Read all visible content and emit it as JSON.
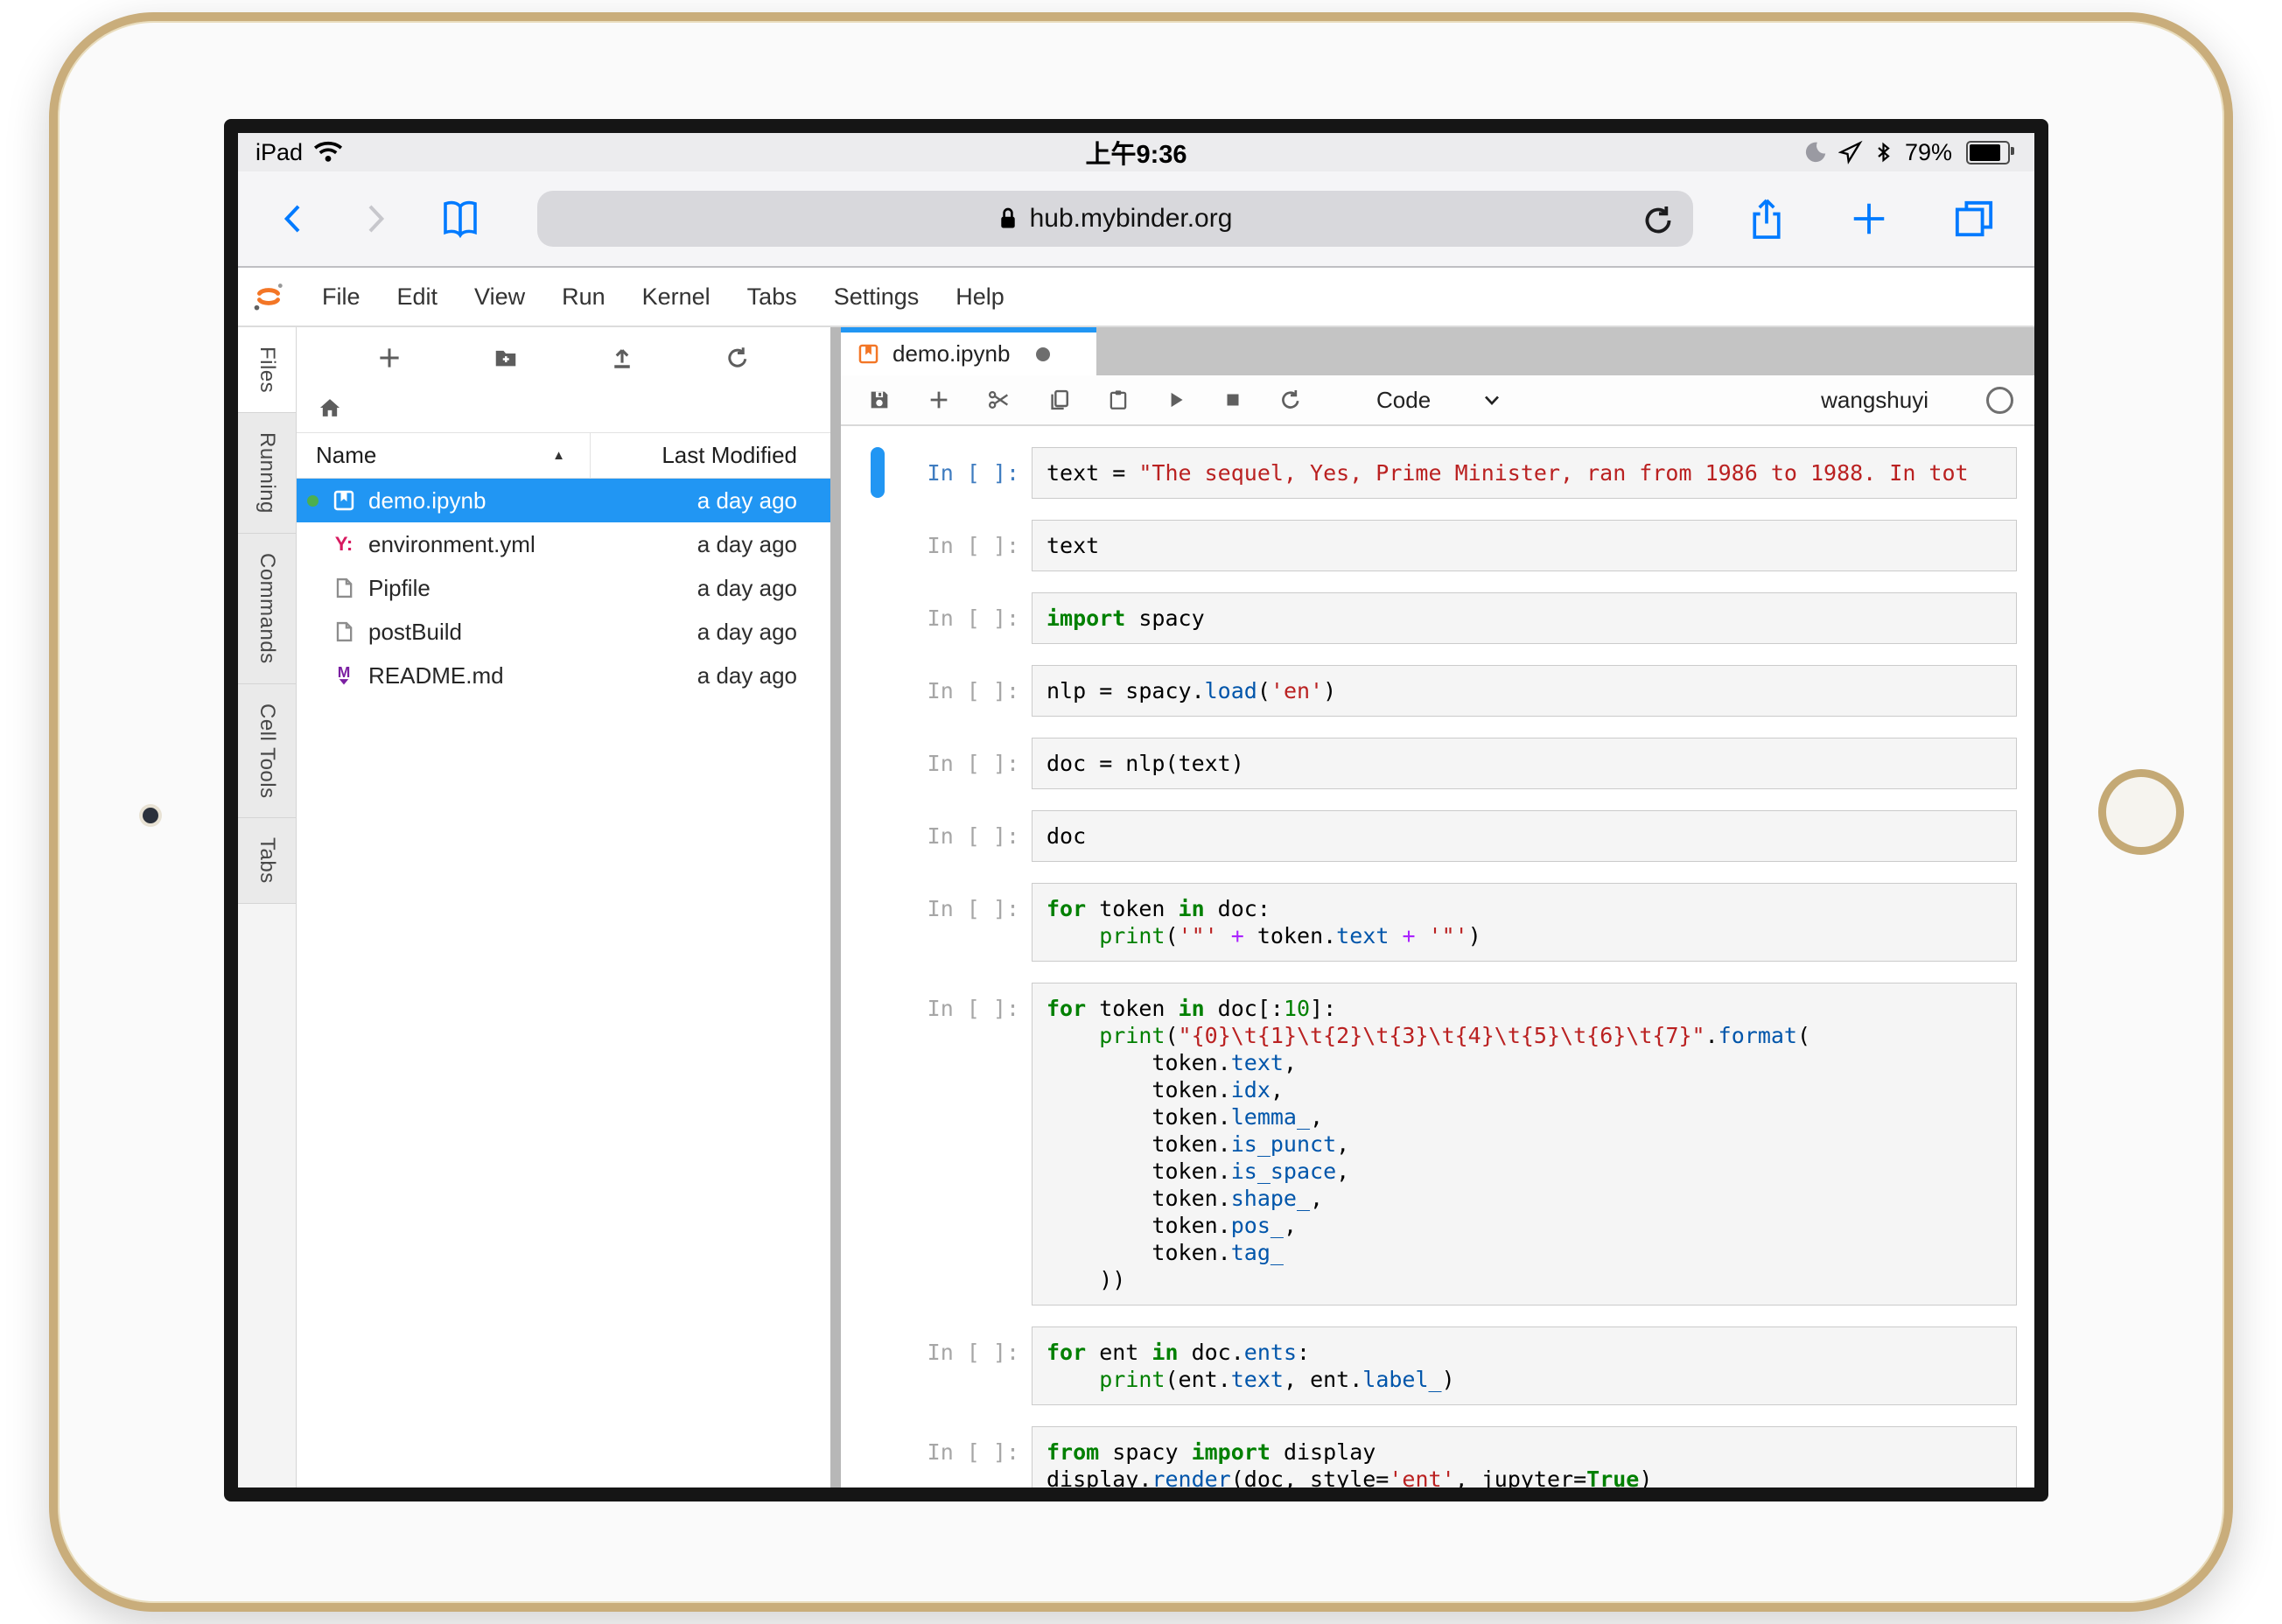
{
  "colors": {
    "accent": "#2196f3",
    "jupyter_orange": "#f37626",
    "safari_blue": "#007aff",
    "selected_row": "#2196f3",
    "string_red": "#ba2121",
    "keyword_green": "#008000",
    "property_blue": "#0055aa"
  },
  "status_bar": {
    "carrier": "iPad",
    "time": "上午9:36",
    "battery_percent": "79%",
    "left_icons": [
      "wifi"
    ],
    "right_icons": [
      "do-not-disturb-moon",
      "location",
      "bluetooth"
    ]
  },
  "safari": {
    "url": "hub.mybinder.org",
    "toolbar_icons": [
      "back",
      "forward",
      "bookmarks",
      "reload",
      "share",
      "new-tab",
      "tabs"
    ]
  },
  "menu_bar": {
    "items": [
      "File",
      "Edit",
      "View",
      "Run",
      "Kernel",
      "Tabs",
      "Settings",
      "Help"
    ]
  },
  "sidebar": {
    "tabs": [
      "Files",
      "Running",
      "Commands",
      "Cell Tools",
      "Tabs"
    ],
    "active_tab": "Files"
  },
  "file_browser": {
    "toolbar_icons": [
      "new-launcher",
      "new-folder",
      "upload",
      "refresh"
    ],
    "breadcrumb_icon": "home",
    "columns": {
      "name": "Name",
      "modified": "Last Modified",
      "sort_caret": "▲"
    },
    "files": [
      {
        "name": "demo.ipynb",
        "modified": "a day ago",
        "icon": "notebook",
        "selected": true,
        "running": true
      },
      {
        "name": "environment.yml",
        "modified": "a day ago",
        "icon": "yaml",
        "selected": false,
        "running": false
      },
      {
        "name": "Pipfile",
        "modified": "a day ago",
        "icon": "file",
        "selected": false,
        "running": false
      },
      {
        "name": "postBuild",
        "modified": "a day ago",
        "icon": "file",
        "selected": false,
        "running": false
      },
      {
        "name": "README.md",
        "modified": "a day ago",
        "icon": "markdown",
        "selected": false,
        "running": false
      }
    ]
  },
  "notebook": {
    "tab_title": "demo.ipynb",
    "tab_icon": "notebook",
    "tab_dirty": true,
    "toolbar_icons": [
      "save",
      "insert-cell",
      "cut-cells",
      "copy-cells",
      "paste-cells",
      "run-cell",
      "stop-kernel",
      "restart-kernel"
    ],
    "cell_type": "Code",
    "kernel_user": "wangshuyi",
    "prompt_label": "In [ ]:",
    "cells": [
      {
        "selected": true,
        "lines": [
          [
            [
              "t",
              "text = "
            ],
            [
              "s",
              "\"The sequel, Yes, Prime Minister, ran from 1986 to 1988. In tot"
            ]
          ]
        ]
      },
      {
        "selected": false,
        "lines": [
          [
            [
              "t",
              "text"
            ]
          ]
        ]
      },
      {
        "selected": false,
        "lines": [
          [
            [
              "k",
              "import"
            ],
            [
              "t",
              " spacy"
            ]
          ]
        ]
      },
      {
        "selected": false,
        "lines": [
          [
            [
              "t",
              "nlp = spacy."
            ],
            [
              "p",
              "load"
            ],
            [
              "t",
              "("
            ],
            [
              "s",
              "'en'"
            ],
            [
              "t",
              ")"
            ]
          ]
        ]
      },
      {
        "selected": false,
        "lines": [
          [
            [
              "t",
              "doc = nlp(text)"
            ]
          ]
        ]
      },
      {
        "selected": false,
        "lines": [
          [
            [
              "t",
              "doc"
            ]
          ]
        ]
      },
      {
        "selected": false,
        "lines": [
          [
            [
              "k",
              "for"
            ],
            [
              "t",
              " token "
            ],
            [
              "k",
              "in"
            ],
            [
              "t",
              " doc:"
            ]
          ],
          [
            [
              "t",
              "    "
            ],
            [
              "b",
              "print"
            ],
            [
              "t",
              "("
            ],
            [
              "s",
              "'\"'"
            ],
            [
              "o",
              " + "
            ],
            [
              "t",
              "token."
            ],
            [
              "p",
              "text"
            ],
            [
              "o",
              " + "
            ],
            [
              "s",
              "'\"'"
            ],
            [
              "t",
              ")"
            ]
          ]
        ]
      },
      {
        "selected": false,
        "lines": [
          [
            [
              "k",
              "for"
            ],
            [
              "t",
              " token "
            ],
            [
              "k",
              "in"
            ],
            [
              "t",
              " doc[:"
            ],
            [
              "n",
              "10"
            ],
            [
              "t",
              "]:"
            ]
          ],
          [
            [
              "t",
              "    "
            ],
            [
              "b",
              "print"
            ],
            [
              "t",
              "("
            ],
            [
              "s",
              "\"{0}\\t{1}\\t{2}\\t{3}\\t{4}\\t{5}\\t{6}\\t{7}\""
            ],
            [
              "t",
              "."
            ],
            [
              "p",
              "format"
            ],
            [
              "t",
              "("
            ]
          ],
          [
            [
              "t",
              "        token."
            ],
            [
              "p",
              "text"
            ],
            [
              "t",
              ","
            ]
          ],
          [
            [
              "t",
              "        token."
            ],
            [
              "p",
              "idx"
            ],
            [
              "t",
              ","
            ]
          ],
          [
            [
              "t",
              "        token."
            ],
            [
              "p",
              "lemma_"
            ],
            [
              "t",
              ","
            ]
          ],
          [
            [
              "t",
              "        token."
            ],
            [
              "p",
              "is_punct"
            ],
            [
              "t",
              ","
            ]
          ],
          [
            [
              "t",
              "        token."
            ],
            [
              "p",
              "is_space"
            ],
            [
              "t",
              ","
            ]
          ],
          [
            [
              "t",
              "        token."
            ],
            [
              "p",
              "shape_"
            ],
            [
              "t",
              ","
            ]
          ],
          [
            [
              "t",
              "        token."
            ],
            [
              "p",
              "pos_"
            ],
            [
              "t",
              ","
            ]
          ],
          [
            [
              "t",
              "        token."
            ],
            [
              "p",
              "tag_"
            ]
          ],
          [
            [
              "t",
              "    ))"
            ]
          ]
        ]
      },
      {
        "selected": false,
        "lines": [
          [
            [
              "k",
              "for"
            ],
            [
              "t",
              " ent "
            ],
            [
              "k",
              "in"
            ],
            [
              "t",
              " doc."
            ],
            [
              "p",
              "ents"
            ],
            [
              "t",
              ":"
            ]
          ],
          [
            [
              "t",
              "    "
            ],
            [
              "b",
              "print"
            ],
            [
              "t",
              "(ent."
            ],
            [
              "p",
              "text"
            ],
            [
              "t",
              ", ent."
            ],
            [
              "p",
              "label_"
            ],
            [
              "t",
              ")"
            ]
          ]
        ]
      },
      {
        "selected": false,
        "lines": [
          [
            [
              "k",
              "from"
            ],
            [
              "t",
              " spacy "
            ],
            [
              "k",
              "import"
            ],
            [
              "t",
              " display"
            ]
          ],
          [
            [
              "t",
              "display."
            ],
            [
              "p",
              "render"
            ],
            [
              "t",
              "(doc, style="
            ],
            [
              "s",
              "'ent'"
            ],
            [
              "t",
              ", jupyter="
            ],
            [
              "k",
              "True"
            ],
            [
              "t",
              ")"
            ]
          ]
        ]
      }
    ]
  }
}
